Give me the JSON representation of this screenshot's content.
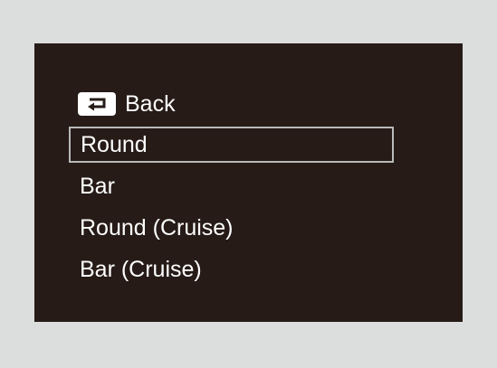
{
  "menu": {
    "back_label": "Back",
    "back_icon": "return-arrow-icon",
    "selected_index": 0,
    "items": [
      {
        "label": "Round"
      },
      {
        "label": "Bar"
      },
      {
        "label": "Round (Cruise)"
      },
      {
        "label": "Bar (Cruise)"
      }
    ]
  },
  "colors": {
    "page_background": "#dcdddd",
    "screen_background": "#261b17",
    "text": "#ffffff",
    "selection_border": "#b9b9b9"
  }
}
